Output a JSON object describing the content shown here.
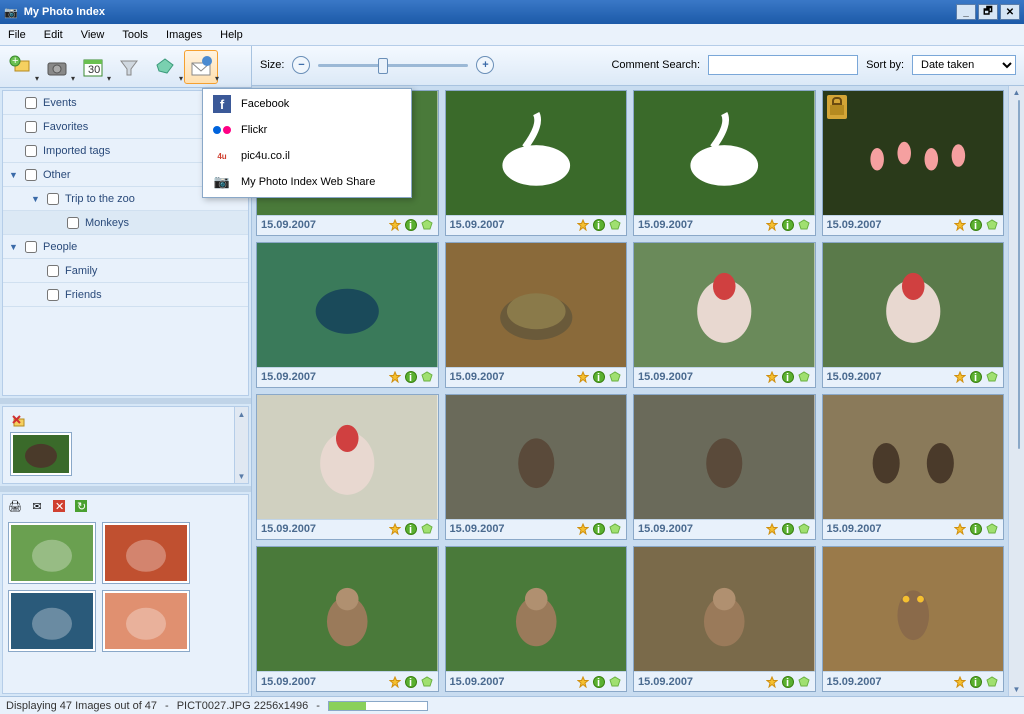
{
  "title": "My Photo Index",
  "menu": [
    "File",
    "Edit",
    "View",
    "Tools",
    "Images",
    "Help"
  ],
  "sidebar": {
    "tags": [
      {
        "label": "Events",
        "expander": "",
        "indent": 0
      },
      {
        "label": "Favorites",
        "expander": "",
        "indent": 0
      },
      {
        "label": "Imported tags",
        "expander": "",
        "indent": 0
      },
      {
        "label": "Other",
        "expander": "▼",
        "indent": 0
      },
      {
        "label": "Trip to the zoo",
        "expander": "▼",
        "indent": 1
      },
      {
        "label": "Monkeys",
        "expander": "",
        "indent": 2,
        "selected": true
      },
      {
        "label": "People",
        "expander": "▼",
        "indent": 0
      },
      {
        "label": "Family",
        "expander": "",
        "indent": 1
      },
      {
        "label": "Friends",
        "expander": "",
        "indent": 1
      }
    ]
  },
  "share_menu": [
    {
      "label": "Facebook",
      "icon": "fb"
    },
    {
      "label": "Flickr",
      "icon": "flickr"
    },
    {
      "label": "pic4u.co.il",
      "icon": "p4u"
    },
    {
      "label": "My Photo Index Web Share",
      "icon": "cam"
    }
  ],
  "toolbar_main": {
    "size_label": "Size:",
    "search_label": "Comment Search:",
    "sort_label": "Sort by:",
    "sort_value": "Date taken"
  },
  "dates": [
    "15.09.2007",
    "15.09.2007",
    "15.09.2007",
    "15.09.2007",
    "15.09.2007",
    "15.09.2007",
    "15.09.2007",
    "15.09.2007",
    "15.09.2007",
    "15.09.2007",
    "15.09.2007",
    "15.09.2007",
    "15.09.2007",
    "15.09.2007",
    "15.09.2007",
    "15.09.2007"
  ],
  "thumbs": [
    {
      "bg": "#4a7a3a",
      "subj": "swan"
    },
    {
      "bg": "#3a6a2a",
      "subj": "swan"
    },
    {
      "bg": "#3a6a2a",
      "subj": "swan"
    },
    {
      "bg": "#2a3a1a",
      "subj": "flamingo",
      "lock": true
    },
    {
      "bg": "#3a7a5a",
      "subj": "bird"
    },
    {
      "bg": "#8a6a3a",
      "subj": "tortoise"
    },
    {
      "bg": "#6a8a5a",
      "subj": "turkey"
    },
    {
      "bg": "#5a7a4a",
      "subj": "turkey"
    },
    {
      "bg": "#d0d0c0",
      "subj": "turkey"
    },
    {
      "bg": "#6a6a5a",
      "subj": "hawk"
    },
    {
      "bg": "#6a6a5a",
      "subj": "hawk"
    },
    {
      "bg": "#8a7a5a",
      "subj": "vulture"
    },
    {
      "bg": "#4a7a3a",
      "subj": "monkey"
    },
    {
      "bg": "#4a7a3a",
      "subj": "monkey"
    },
    {
      "bg": "#7a6a4a",
      "subj": "monkey"
    },
    {
      "bg": "#9a7a4a",
      "subj": "owl"
    }
  ],
  "mini_thumbs": [
    {
      "bg": "#6aa050"
    },
    {
      "bg": "#c05030"
    },
    {
      "bg": "#2a5a7a"
    },
    {
      "bg": "#e09070"
    }
  ],
  "selected_thumb": {
    "bg": "#3a6a2a"
  },
  "status": {
    "left": "Displaying 47 Images out of 47",
    "sep": "-",
    "file": "PICT0027.JPG 2256x1496",
    "sep2": "-"
  }
}
